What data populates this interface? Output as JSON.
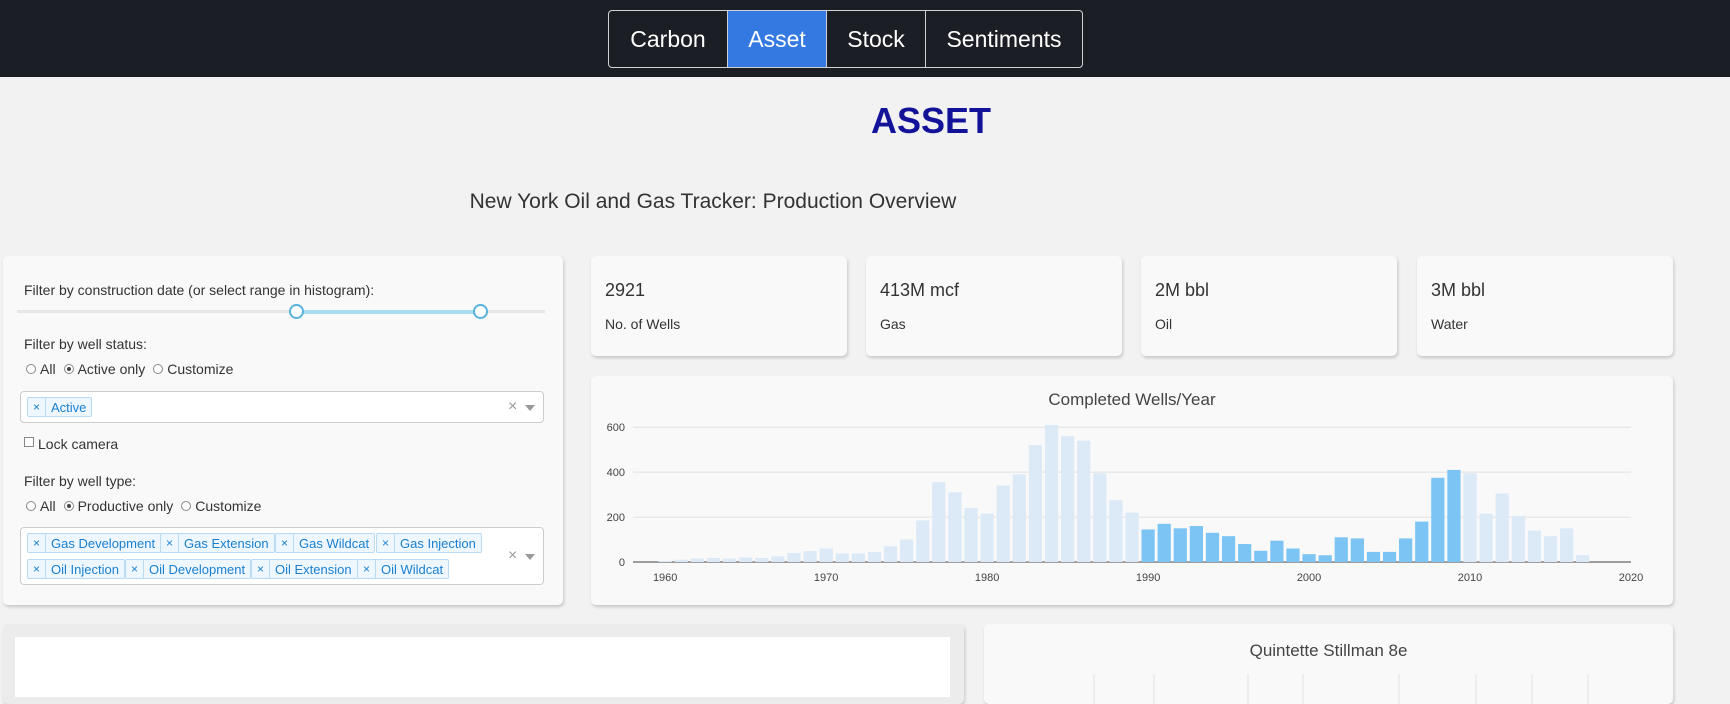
{
  "nav": {
    "tabs": [
      {
        "label": "Carbon",
        "active": false
      },
      {
        "label": "Asset",
        "active": true
      },
      {
        "label": "Stock",
        "active": false
      },
      {
        "label": "Sentiments",
        "active": false
      }
    ],
    "active_color": "#3479e2"
  },
  "page_title": "ASSET",
  "subtitle": "New York Oil and Gas Tracker: Production Overview",
  "filters": {
    "date_label": "Filter by construction date (or select range in histogram):",
    "date_range": [
      1990,
      2010
    ],
    "status_label": "Filter by well status:",
    "status_options": [
      "All",
      "Active only",
      "Customize"
    ],
    "status_selected": "Active only",
    "status_tags": [
      "Active"
    ],
    "lock_camera_label": "Lock camera",
    "lock_camera_checked": false,
    "type_label": "Filter by well type:",
    "type_options": [
      "All",
      "Productive only",
      "Customize"
    ],
    "type_selected": "Productive only",
    "type_tags": [
      "Gas Development",
      "Gas Extension",
      "Gas Wildcat",
      "Gas Injection",
      "Oil Injection",
      "Oil Development",
      "Oil Extension",
      "Oil Wildcat"
    ]
  },
  "stats": [
    {
      "value": "2921",
      "label": "No. of Wells"
    },
    {
      "value": "413M mcf",
      "label": "Gas"
    },
    {
      "value": "2M bbl",
      "label": "Oil"
    },
    {
      "value": "3M bbl",
      "label": "Water"
    }
  ],
  "chart_data": {
    "type": "bar",
    "title": "Completed Wells/Year",
    "xlim": [
      1958,
      2020
    ],
    "ylim": [
      0,
      650
    ],
    "x_ticks": [
      "1960",
      "1970",
      "1980",
      "1990",
      "2000",
      "2010",
      "2020"
    ],
    "y_ticks": [
      "0",
      "200",
      "400",
      "600"
    ],
    "selected_range": [
      1990,
      2010
    ],
    "selected_color": "#7bc4f4",
    "unselected_color": "#dce9f6",
    "years": [
      1960,
      1961,
      1962,
      1963,
      1964,
      1965,
      1966,
      1967,
      1968,
      1969,
      1970,
      1971,
      1972,
      1973,
      1974,
      1975,
      1976,
      1977,
      1978,
      1979,
      1980,
      1981,
      1982,
      1983,
      1984,
      1985,
      1986,
      1987,
      1988,
      1989,
      1990,
      1991,
      1992,
      1993,
      1994,
      1995,
      1996,
      1997,
      1998,
      1999,
      2000,
      2001,
      2002,
      2003,
      2004,
      2005,
      2006,
      2007,
      2008,
      2009,
      2010,
      2011,
      2012,
      2013,
      2014,
      2015,
      2016,
      2017
    ],
    "values": [
      5,
      10,
      15,
      18,
      15,
      20,
      18,
      25,
      40,
      48,
      60,
      38,
      38,
      45,
      70,
      100,
      185,
      355,
      310,
      240,
      215,
      340,
      390,
      520,
      610,
      560,
      540,
      395,
      275,
      220,
      145,
      170,
      150,
      160,
      130,
      115,
      80,
      50,
      95,
      60,
      35,
      30,
      110,
      105,
      45,
      45,
      105,
      180,
      375,
      410,
      395,
      215,
      305,
      205,
      140,
      115,
      150,
      30,
      20
    ]
  },
  "bottom_chart": {
    "title": "Quintette Stillman 8e"
  }
}
